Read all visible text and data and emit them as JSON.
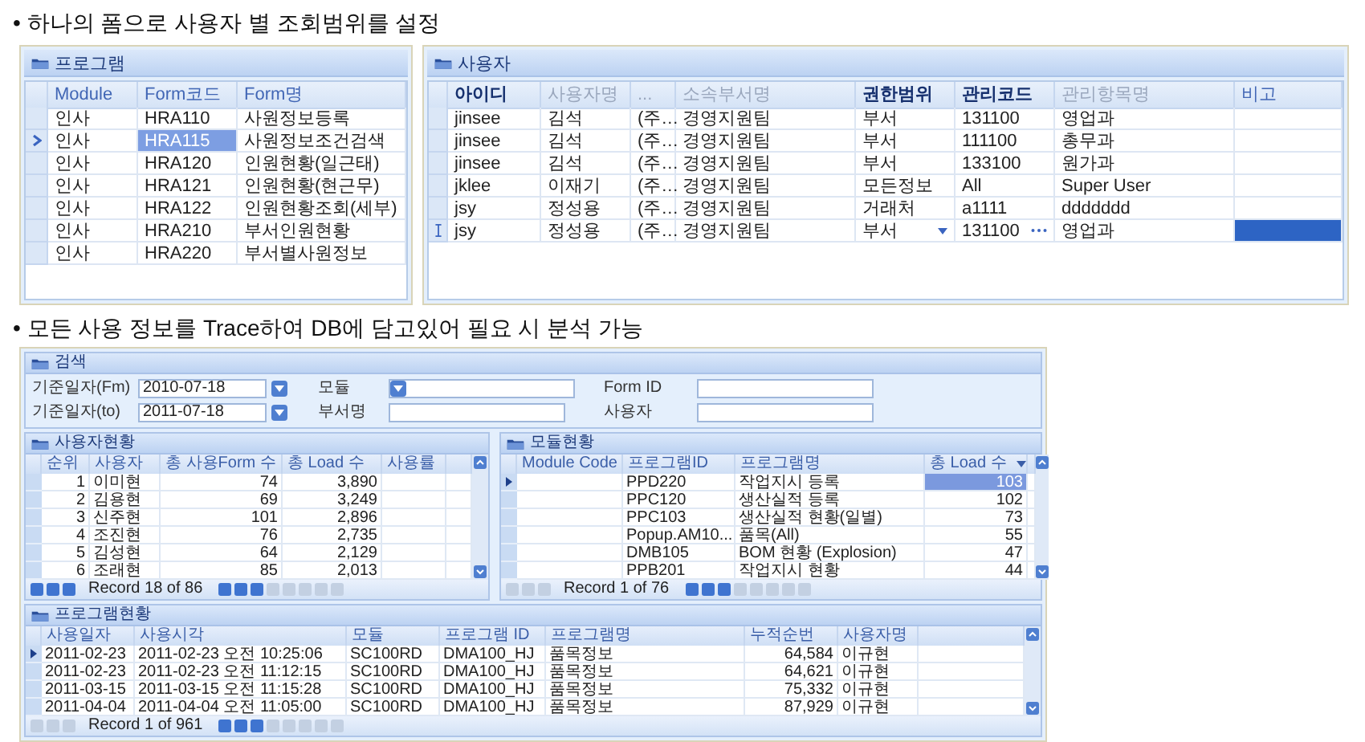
{
  "heading_1": "• 하나의 폼으로 사용자 별 조회범위를 설정",
  "top_grids": [
    {
      "title": "프로그램",
      "columns": [
        {
          "label": "Module",
          "kind": "plain"
        },
        {
          "label": "Form코드",
          "kind": "plain",
          "focus": true
        },
        {
          "label": "Form명",
          "kind": "plain"
        }
      ],
      "rows": [
        {
          "cells": [
            "인사",
            "HRA110",
            "사원정보등록"
          ],
          "selected": false
        },
        {
          "cells": [
            "인사",
            "HRA115",
            "사원정보조건검색"
          ],
          "selected": true
        },
        {
          "cells": [
            "인사",
            "HRA120",
            "인원현황(일근태)"
          ],
          "selected": false
        },
        {
          "cells": [
            "인사",
            "HRA121",
            "인원현황(현근무)"
          ],
          "selected": false
        },
        {
          "cells": [
            "인사",
            "HRA122",
            "인원현황조회(세부)"
          ],
          "selected": false
        },
        {
          "cells": [
            "인사",
            "HRA210",
            "부서인원현황"
          ],
          "selected": false
        },
        {
          "cells": [
            "인사",
            "HRA220",
            "부서별사원정보"
          ],
          "selected": false
        }
      ]
    },
    {
      "title": "사용자",
      "columns": [
        {
          "label": "아이디",
          "kind": "key"
        },
        {
          "label": "사용자명",
          "kind": "readonly"
        },
        {
          "label": "...",
          "kind": "readonly"
        },
        {
          "label": "소속부서명",
          "kind": "readonly"
        },
        {
          "label": "권한범위",
          "kind": "dropdown"
        },
        {
          "label": "관리코드",
          "kind": "lookup"
        },
        {
          "label": "관리항목명",
          "kind": "readonly"
        },
        {
          "label": "비고",
          "kind": "plain",
          "focus": true
        }
      ],
      "rows": [
        {
          "cells": [
            "jinsee",
            "김석",
            "(주…",
            "경영지원팀",
            "부서",
            "131100",
            "영업과",
            ""
          ],
          "selected": false
        },
        {
          "cells": [
            "jinsee",
            "김석",
            "(주…",
            "경영지원팀",
            "부서",
            "111100",
            "총무과",
            ""
          ],
          "selected": false
        },
        {
          "cells": [
            "jinsee",
            "김석",
            "(주…",
            "경영지원팀",
            "부서",
            "133100",
            "원가과",
            ""
          ],
          "selected": false
        },
        {
          "cells": [
            "jklee",
            "이재기",
            "(주…",
            "경영지원팀",
            "모든정보",
            "All",
            "Super User",
            ""
          ],
          "selected": false
        },
        {
          "cells": [
            "jsy",
            "정성용",
            "(주…",
            "경영지원팀",
            "거래처",
            "a1111",
            "ddddddd",
            ""
          ],
          "selected": false
        },
        {
          "cells": [
            "jsy",
            "정성용",
            "(주…",
            "경영지원팀",
            "부서",
            "131100",
            "영업과",
            ""
          ],
          "selected": true
        }
      ]
    }
  ],
  "heading_2": "• 모든 사용 정보를 Trace하여 DB에 담고있어 필요 시 분석 가능",
  "log_window": {
    "search": {
      "title": "검색",
      "fields": [
        {
          "label": "기준일자(Fm)",
          "kind": "date",
          "value": "2010-07-18"
        },
        {
          "label": "모듈",
          "kind": "combo"
        },
        {
          "label": "Form ID",
          "kind": "text"
        },
        {
          "label": "기준일자(to)",
          "kind": "date",
          "value": "2011-07-18"
        },
        {
          "label": "부서명",
          "kind": "text"
        },
        {
          "label": "사용자",
          "kind": "text"
        }
      ]
    },
    "grids": [
      {
        "title": "사용자현황",
        "columns": [
          {
            "label": "순위"
          },
          {
            "label": "사용자"
          },
          {
            "label": "총 사용Form 수"
          },
          {
            "label": "총 Load 수"
          },
          {
            "label": "사용률"
          }
        ],
        "rows": [
          {
            "cells": [
              "1",
              "이미현",
              "74",
              "3,890",
              ""
            ],
            "selected": false
          },
          {
            "cells": [
              "2",
              "김용현",
              "69",
              "3,249",
              ""
            ],
            "selected": false
          },
          {
            "cells": [
              "3",
              "신주현",
              "101",
              "2,896",
              ""
            ],
            "selected": false
          },
          {
            "cells": [
              "4",
              "조진현",
              "76",
              "2,735",
              ""
            ],
            "selected": false
          },
          {
            "cells": [
              "5",
              "김성현",
              "64",
              "2,129",
              ""
            ],
            "selected": false
          },
          {
            "cells": [
              "6",
              "조래현",
              "85",
              "2,013",
              ""
            ],
            "selected": false
          }
        ],
        "pager": {
          "label": "Record 18 of 86",
          "buttons": [
            {
              "disabled": false
            },
            {
              "disabled": false
            },
            {
              "disabled": false
            },
            {
              "disabled": false
            },
            {
              "disabled": false
            },
            {
              "disabled": false
            },
            {
              "disabled": true
            },
            {
              "disabled": true
            },
            {
              "disabled": true
            },
            {
              "disabled": true
            },
            {
              "disabled": true
            }
          ]
        }
      },
      {
        "title": "모듈현황",
        "columns": [
          {
            "label": "Module Code"
          },
          {
            "label": "프로그램ID"
          },
          {
            "label": "프로그램명"
          },
          {
            "label": "총 Load 수",
            "focus": true,
            "sorted": true
          }
        ],
        "rows": [
          {
            "cells": [
              "",
              "PPD220",
              "작업지시 등록",
              "103"
            ],
            "selected": true
          },
          {
            "cells": [
              "",
              "PPC120",
              "생산실적 등록",
              "102"
            ],
            "selected": false
          },
          {
            "cells": [
              "",
              "PPC103",
              "생산실적 현황(일별)",
              "73"
            ],
            "selected": false
          },
          {
            "cells": [
              "",
              "Popup.AM10...",
              "품목(All)",
              "55"
            ],
            "selected": false
          },
          {
            "cells": [
              "",
              "DMB105",
              "BOM 현황 (Explosion)",
              "47"
            ],
            "selected": false
          },
          {
            "cells": [
              "",
              "PPB201",
              "작업지시 현황",
              "44"
            ],
            "selected": false
          }
        ],
        "pager": {
          "label": "Record 1 of 76",
          "buttons": [
            {
              "disabled": true
            },
            {
              "disabled": true
            },
            {
              "disabled": true
            },
            {
              "disabled": false
            },
            {
              "disabled": false
            },
            {
              "disabled": false
            },
            {
              "disabled": true
            },
            {
              "disabled": true
            },
            {
              "disabled": true
            },
            {
              "disabled": true
            },
            {
              "disabled": true
            }
          ]
        }
      },
      {
        "title": "프로그램현황",
        "columns": [
          {
            "label": "사용일자"
          },
          {
            "label": "사용시각"
          },
          {
            "label": "모듈"
          },
          {
            "label": "프로그램 ID"
          },
          {
            "label": "프로그램명"
          },
          {
            "label": "누적순번"
          },
          {
            "label": "사용자명"
          }
        ],
        "rows": [
          {
            "cells": [
              "2011-02-23",
              "2011-02-23 오전 10:25:06",
              "SC100RD",
              "DMA100_HJ",
              "품목정보",
              "64,584",
              "이규현"
            ],
            "selected": true
          },
          {
            "cells": [
              "2011-02-23",
              "2011-02-23 오전 11:12:15",
              "SC100RD",
              "DMA100_HJ",
              "품목정보",
              "64,621",
              "이규현"
            ],
            "selected": false
          },
          {
            "cells": [
              "2011-03-15",
              "2011-03-15 오전 11:15:28",
              "SC100RD",
              "DMA100_HJ",
              "품목정보",
              "75,332",
              "이규현"
            ],
            "selected": false
          },
          {
            "cells": [
              "2011-04-04",
              "2011-04-04 오전 11:05:00",
              "SC100RD",
              "DMA100_HJ",
              "품목정보",
              "87,929",
              "이규현"
            ],
            "selected": false
          }
        ],
        "pager": {
          "label": "Record 1 of 961",
          "buttons": [
            {
              "disabled": true
            },
            {
              "disabled": true
            },
            {
              "disabled": true
            },
            {
              "disabled": false
            },
            {
              "disabled": false
            },
            {
              "disabled": false
            },
            {
              "disabled": true
            },
            {
              "disabled": true
            },
            {
              "disabled": true
            },
            {
              "disabled": true
            },
            {
              "disabled": true
            }
          ]
        }
      }
    ]
  }
}
